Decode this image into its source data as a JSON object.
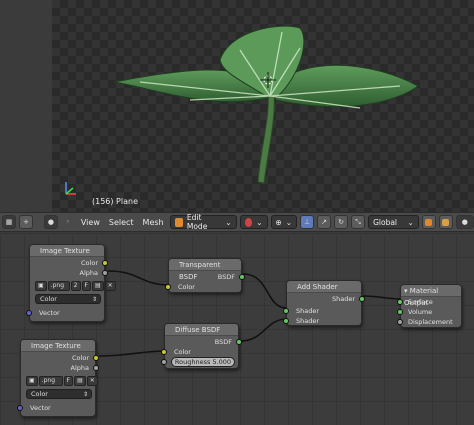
{
  "viewport": {
    "object_label": "(156) Plane"
  },
  "header": {
    "menus": [
      "View",
      "Select",
      "Mesh"
    ],
    "mode": "Edit Mode",
    "orientation": "Global"
  },
  "nodes": {
    "image_texture_1": {
      "title": "Image Texture",
      "out_color": "Color",
      "out_alpha": "Alpha",
      "file": ".png",
      "users": "2",
      "fake_user": "F",
      "color_space": "Color",
      "in_vector": "Vector"
    },
    "image_texture_2": {
      "title": "Image Texture",
      "out_color": "Color",
      "out_alpha": "Alpha",
      "file": ".png",
      "fake_user": "F",
      "color_space": "Color",
      "in_vector": "Vector"
    },
    "transparent_bsdf": {
      "title": "Transparent BSDF",
      "out_bsdf": "BSDF",
      "in_color": "Color"
    },
    "diffuse_bsdf": {
      "title": "Diffuse BSDF",
      "out_bsdf": "BSDF",
      "in_color": "Color",
      "roughness": "Roughness 5.000"
    },
    "add_shader": {
      "title": "Add Shader",
      "out_shader": "Shader",
      "in_shader_1": "Shader",
      "in_shader_2": "Shader"
    },
    "material_output": {
      "title": "Material Output",
      "in_surface": "Surface",
      "in_volume": "Volume",
      "in_displacement": "Displacement"
    }
  },
  "colors": {
    "socket_color": "#c7c729",
    "socket_shader": "#63c763",
    "socket_vector": "#6363c7",
    "socket_float": "#a1a1a1"
  }
}
